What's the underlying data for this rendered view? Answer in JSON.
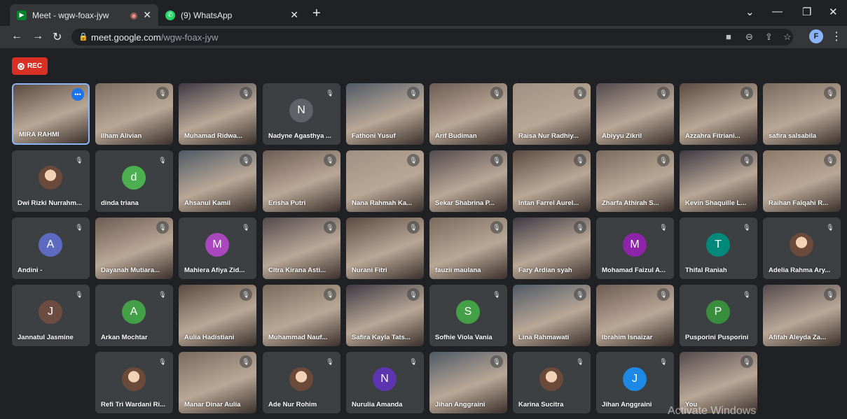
{
  "tabs": [
    {
      "title": "Meet - wgw-foax-jyw",
      "favicon": "meet-icon",
      "recording": true
    },
    {
      "title": "(9) WhatsApp",
      "favicon": "whatsapp-icon",
      "recording": false
    }
  ],
  "address_bar": {
    "host": "meet.google.com",
    "path": "/wgw-foax-jyw"
  },
  "profile_initial": "F",
  "rec_label": "REC",
  "watermark": "Activate Windows",
  "colors": {
    "accent": "#1a73e8",
    "rec": "#d93025",
    "tile": "#3c4043",
    "background": "#202124"
  },
  "participants": [
    {
      "name": "MIRA RAHMI",
      "video": true,
      "self_highlight": true
    },
    {
      "name": "Ilham Alivian",
      "video": true
    },
    {
      "name": "Muhamad Ridwa...",
      "video": true
    },
    {
      "name": "Nadyne Agasthya ...",
      "initial": "N",
      "color": "#5f6368"
    },
    {
      "name": "Fathoni Yusuf",
      "video": true
    },
    {
      "name": "Arif Budiman",
      "video": true
    },
    {
      "name": "Raisa Nur Radhiy...",
      "video": true
    },
    {
      "name": "Abiyyu Zikril",
      "video": true
    },
    {
      "name": "Azzahra Fitriani...",
      "video": true
    },
    {
      "name": "safira salsabila",
      "video": true
    },
    {
      "name": "Dwi Rizki Nurrahm...",
      "photo": true
    },
    {
      "name": "dinda triana",
      "initial": "d",
      "color": "#4caf50"
    },
    {
      "name": "Ahsanul Kamil",
      "video": true
    },
    {
      "name": "Erisha Putri",
      "video": true
    },
    {
      "name": "Nana Rahmah Ka...",
      "video": true
    },
    {
      "name": "Sekar Shabrina P...",
      "video": true
    },
    {
      "name": "Intan Farrel Aurel...",
      "video": true
    },
    {
      "name": "Zharfa Athirah S...",
      "video": true
    },
    {
      "name": "Kevin Shaquille L...",
      "video": true
    },
    {
      "name": "Raihan Falqahi R...",
      "video": true
    },
    {
      "name": "Andini -",
      "initial": "A",
      "color": "#5c6bc0"
    },
    {
      "name": "Dayanah Mutiara...",
      "video": true
    },
    {
      "name": "Mahiera Afiya Zid...",
      "initial": "M",
      "color": "#ab47bc"
    },
    {
      "name": "Citra Kirana Asti...",
      "video": true
    },
    {
      "name": "Nurani Fitri",
      "video": true
    },
    {
      "name": "fauzii maulana",
      "video": true
    },
    {
      "name": "Fary Ardian syah",
      "video": true
    },
    {
      "name": "Mohamad Faizul A...",
      "initial": "M",
      "color": "#8e24aa"
    },
    {
      "name": "Thifal Raniah",
      "initial": "T",
      "color": "#00897b"
    },
    {
      "name": "Adelia Rahma Ary...",
      "photo": true
    },
    {
      "name": "Jannatul Jasmine",
      "initial": "J",
      "color": "#6d4c41"
    },
    {
      "name": "Arkan Mochtar",
      "initial": "A",
      "color": "#43a047"
    },
    {
      "name": "Aulia Hadistiani",
      "video": true
    },
    {
      "name": "Muhammad Nauf...",
      "video": true
    },
    {
      "name": "Safira Kayla Tats...",
      "video": true
    },
    {
      "name": "Sofhie Viola Vania",
      "initial": "S",
      "color": "#43a047"
    },
    {
      "name": "Lina Rahmawati",
      "video": true
    },
    {
      "name": "Ibrahim Isnaizar",
      "video": true
    },
    {
      "name": "Pusporini Pusporini",
      "initial": "P",
      "color": "#388e3c"
    },
    {
      "name": "Afifah Aleyda Za...",
      "video": true
    },
    {
      "name": "Refi Tri Wardani Ri...",
      "photo": true
    },
    {
      "name": "Manar Dinar Aulia",
      "video": true
    },
    {
      "name": "Ade Nur Rohim",
      "photo": true
    },
    {
      "name": "Nurulia Amanda",
      "initial": "N",
      "color": "#5e35b1"
    },
    {
      "name": "Jihan Anggraini",
      "video": true
    },
    {
      "name": "Karina Sucitra",
      "photo": true
    },
    {
      "name": "Jihan Anggraini",
      "initial": "J",
      "color": "#1e88e5"
    },
    {
      "name": "You",
      "video": true
    }
  ]
}
